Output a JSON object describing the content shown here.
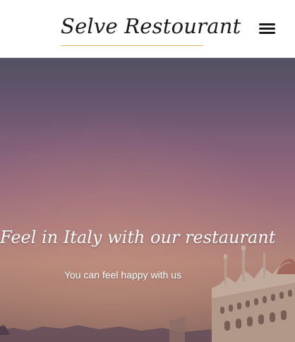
{
  "header": {
    "logo_text": "Selve Restourant",
    "menu_icon": "hamburger-menu-icon"
  },
  "hero": {
    "title": "Feel in Italy with our restaurant",
    "subtitle": "You can feel happy with us"
  },
  "colors": {
    "logo_underline": "#d8b560",
    "hero_text": "#ffffff",
    "header_bg": "#ffffff"
  }
}
